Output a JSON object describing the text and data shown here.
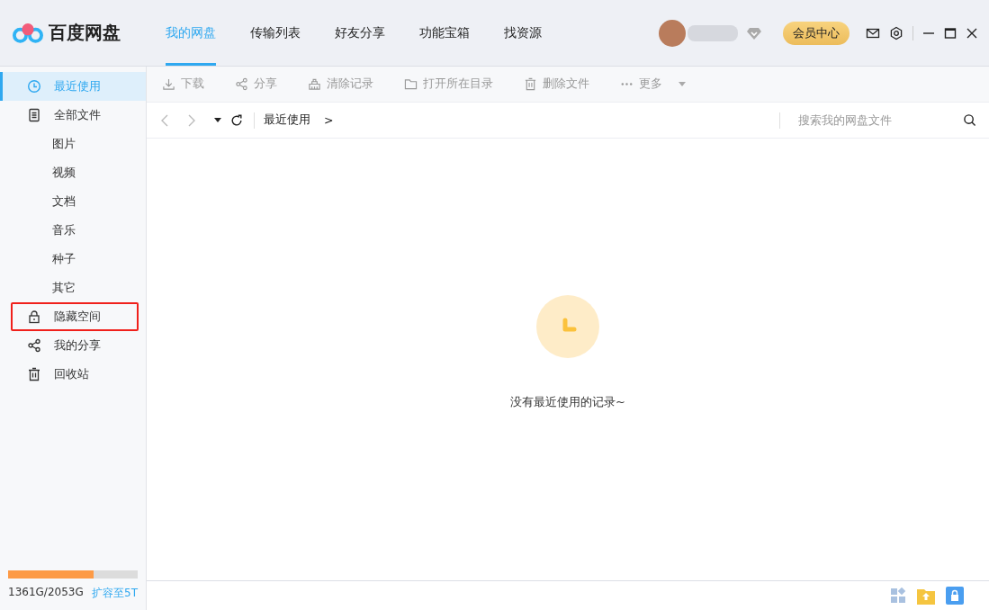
{
  "app": {
    "title": "百度网盘"
  },
  "tabs": [
    {
      "label": "我的网盘",
      "selected": true
    },
    {
      "label": "传输列表",
      "selected": false
    },
    {
      "label": "好友分享",
      "selected": false
    },
    {
      "label": "功能宝箱",
      "selected": false
    },
    {
      "label": "找资源",
      "selected": false
    }
  ],
  "header": {
    "vip_button": "会员中心"
  },
  "sidebar": {
    "items": [
      {
        "label": "最近使用",
        "kind": "clock",
        "selected": true,
        "highlighted": false
      },
      {
        "label": "全部文件",
        "kind": "doc",
        "selected": false,
        "highlighted": false,
        "children": [
          {
            "label": "图片",
            "selected": false
          },
          {
            "label": "视频",
            "selected": false
          },
          {
            "label": "文档",
            "selected": false
          },
          {
            "label": "音乐",
            "selected": false
          },
          {
            "label": "种子",
            "selected": false
          },
          {
            "label": "其它",
            "selected": false
          }
        ]
      },
      {
        "label": "隐藏空间",
        "kind": "lock",
        "selected": false,
        "highlighted": true
      },
      {
        "label": "我的分享",
        "kind": "share",
        "selected": false,
        "highlighted": false
      },
      {
        "label": "回收站",
        "kind": "trash",
        "selected": false,
        "highlighted": false
      }
    ],
    "storage": {
      "level": 0.663,
      "usage": "1361G/2053G",
      "upgrade_link": "扩容至5T"
    }
  },
  "toolbar": [
    {
      "kind": "download",
      "label": "下载",
      "disabled": true
    },
    {
      "kind": "share",
      "label": "分享",
      "disabled": true
    },
    {
      "kind": "clear",
      "label": "清除记录",
      "disabled": true
    },
    {
      "kind": "folder",
      "label": "打开所在目录",
      "disabled": true
    },
    {
      "kind": "delete",
      "label": "删除文件",
      "disabled": true
    },
    {
      "kind": "more",
      "label": "更多",
      "disabled": true
    }
  ],
  "path_bar": {
    "crumb": "最近使用",
    "separator": ">",
    "search": {
      "placeholder": "搜索我的网盘文件"
    }
  },
  "empty_state": {
    "message": "没有最近使用的记录~"
  }
}
